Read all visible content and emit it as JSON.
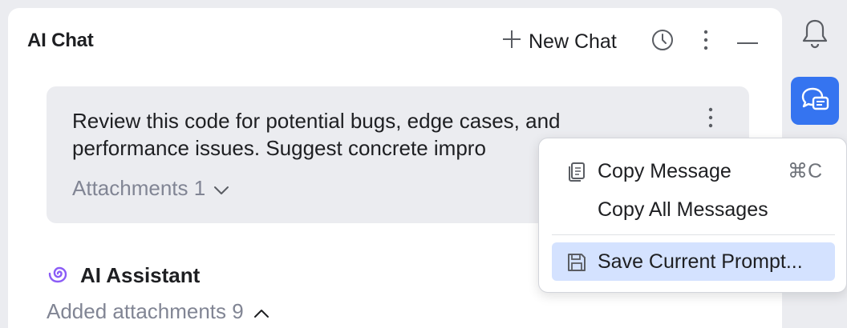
{
  "panel": {
    "title": "AI Chat",
    "new_chat_label": "New Chat"
  },
  "user_message": {
    "text": "Review this code for potential bugs, edge cases, and\nperformance issues. Suggest concrete impro",
    "attachments_label": "Attachments 1"
  },
  "assistant": {
    "name": "AI Assistant",
    "added_attachments_label": "Added attachments 9"
  },
  "context_menu": {
    "items": [
      {
        "label": "Copy Message",
        "shortcut": "⌘C",
        "icon": "copy-icon"
      },
      {
        "label": "Copy All Messages",
        "shortcut": "",
        "icon": ""
      },
      {
        "label": "Save Current Prompt...",
        "shortcut": "",
        "icon": "save-icon"
      }
    ],
    "highlighted_index": 2
  },
  "icons": {
    "new_chat": "plus-icon",
    "history": "clock-icon",
    "more": "vertical-ellipsis-icon",
    "minimize": "minus-icon",
    "attachments_toggle": "chevron-down-icon",
    "added_attachments_toggle": "chevron-up-icon",
    "assistant_logo": "spiral-icon",
    "notifications": "bell-icon",
    "ai_chat_tool": "chat-bubble-icon"
  },
  "colors": {
    "accent": "#3574f0",
    "assistant_logo": "#8b5cf6",
    "highlight": "#d4e2ff",
    "muted_text": "#818594",
    "message_bg": "#ebecf0"
  }
}
